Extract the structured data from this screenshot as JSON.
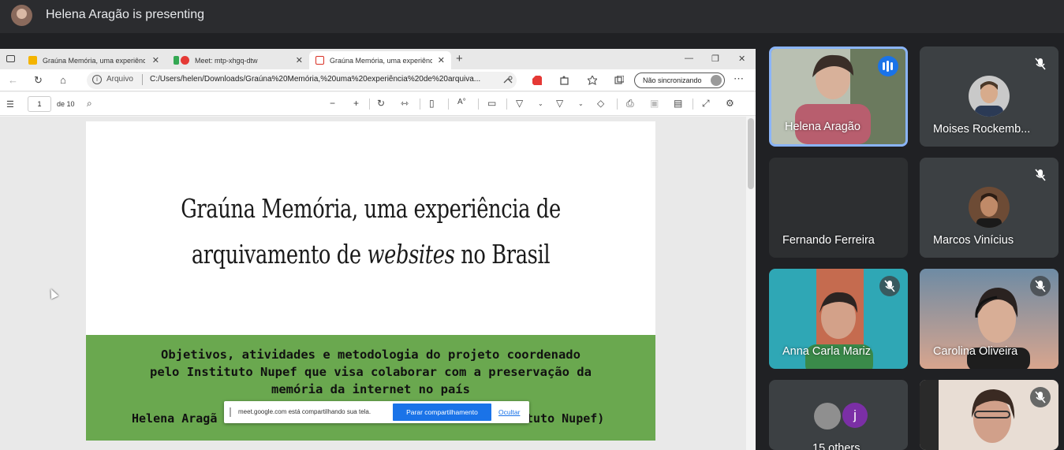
{
  "meet": {
    "presenting_banner": "Helena Aragão is presenting"
  },
  "browser": {
    "tabs": [
      {
        "label": "Graúna Memória, uma experiênc",
        "favicon_color": "#f4b400"
      },
      {
        "label": "Meet: mtp-xhgq-dtw",
        "favicon_color": "#e53935"
      },
      {
        "label": "Graúna Memória, uma experiênc",
        "favicon_color": "#d93025"
      }
    ],
    "address": {
      "scheme_label": "Arquivo",
      "url": "C:/Users/helen/Downloads/Graúna%20Memória,%20uma%20experiência%20de%20arquiva...",
      "sync_label": "Não sincronizando"
    },
    "pdf_toolbar": {
      "page_number": "1",
      "page_total": "de 10"
    }
  },
  "slide": {
    "title_line1": "Graúna Memória, uma experiência de",
    "title_line2_a": "arquivamento de ",
    "title_line2_italic": "websites",
    "title_line2_b": " no Brasil",
    "subtitle_line1": "Objetivos, atividades e metodologia do projeto coordenado",
    "subtitle_line2": "pelo Instituto Nupef que visa colaborar com a preservação da",
    "subtitle_line3": "memória da internet no país",
    "author_left": "Helena Aragã",
    "author_right": "tuto Nupef)"
  },
  "share_bar": {
    "message": "meet.google.com está compartilhando sua tela.",
    "stop_label": "Parar compartilhamento",
    "hide_label": "Ocultar"
  },
  "participants": [
    {
      "name": "Helena Aragão",
      "muted": false,
      "speaking": true
    },
    {
      "name": "Moises Rockemb...",
      "muted": true
    },
    {
      "name": "Fernando Ferreira",
      "muted": false
    },
    {
      "name": "Marcos Vinícius",
      "muted": true
    },
    {
      "name": "Anna Carla Mariz",
      "muted": true
    },
    {
      "name": "Carolina Oliveira",
      "muted": true
    },
    {
      "name": "15 others",
      "avatar_letter": "j",
      "avatar_color": "#7b2fa6"
    },
    {
      "name": "",
      "muted": true
    }
  ]
}
